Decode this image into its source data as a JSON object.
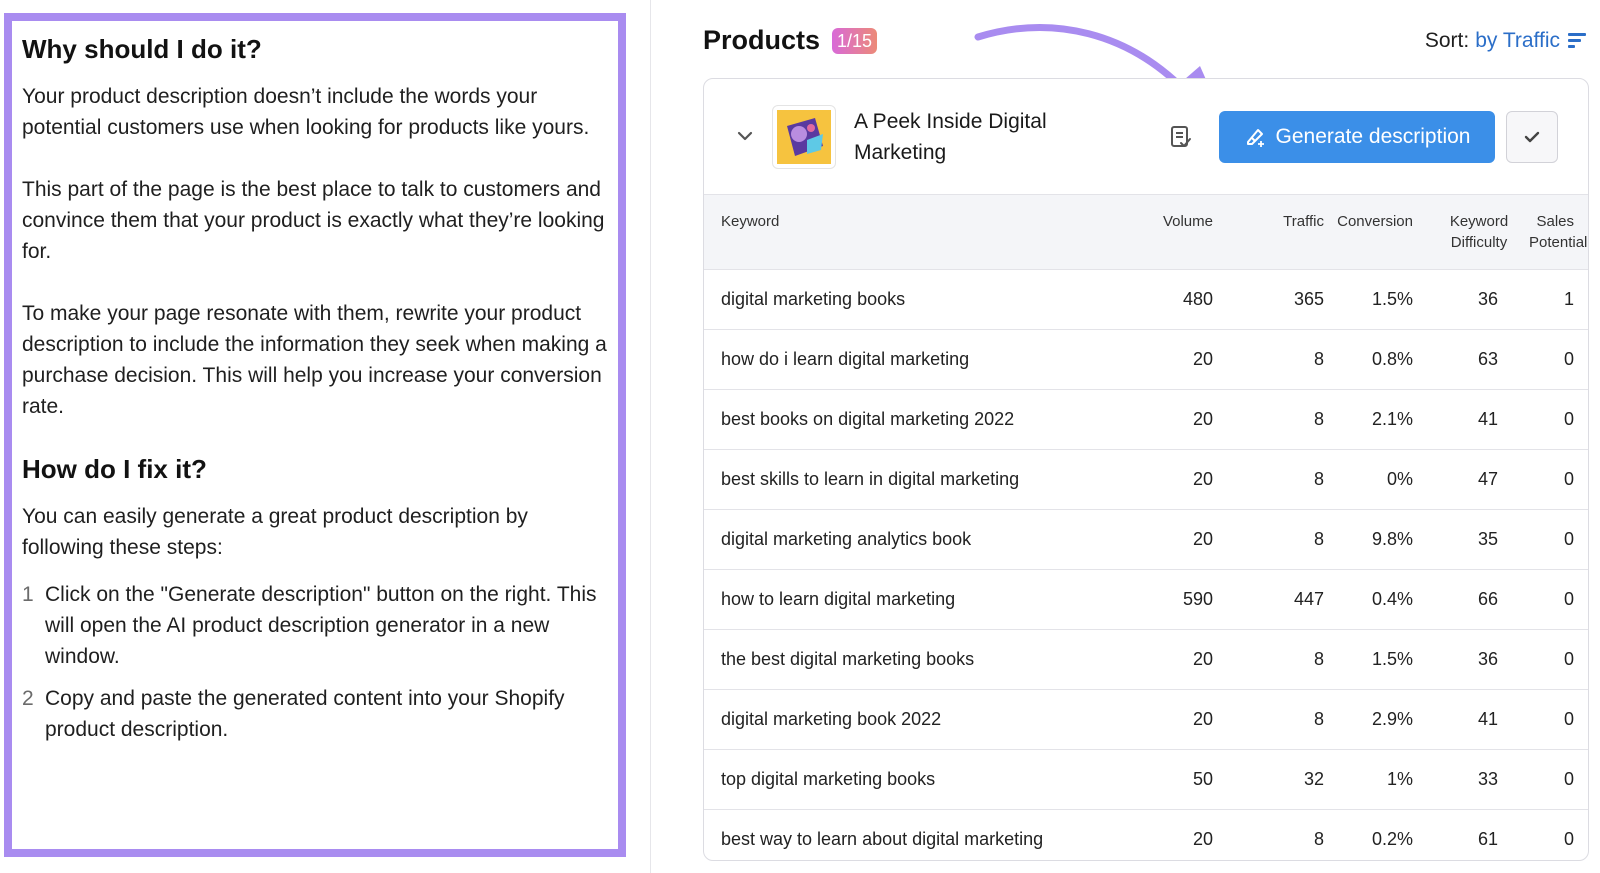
{
  "left": {
    "why_heading": "Why should I do it?",
    "why_p1": "Your product description doesn’t include the words your potential customers use when looking for products like yours.",
    "why_p2": "This part of the page is the best place to talk to customers and convince them that your product is exactly what they’re looking for.",
    "why_p3": "To make your page resonate with them, rewrite your product description to include the information they seek when making a purchase decision. This will help you increase your conversion rate.",
    "fix_heading": "How do I fix it?",
    "fix_intro": "You can easily generate a great product description by following these steps:",
    "steps": [
      {
        "num": "1",
        "text": "Click on the \"Generate description\" button on the right. This will open the AI product description generator in a new window."
      },
      {
        "num": "2",
        "text": "Copy and paste the generated content into your Shopify product description."
      }
    ],
    "highlight_color": "#a98cf0"
  },
  "products": {
    "title": "Products",
    "count_badge": "1/15",
    "sort_label": "Sort:",
    "sort_value": "by Traffic",
    "sort_icon": "sort-lines-icon",
    "product": {
      "name": "A Peek Inside Digital Marketing",
      "thumb_icon": "book-cover-image",
      "expand_icon": "chevron-down-icon",
      "doc_icon": "document-check-icon",
      "generate_label": "Generate description",
      "generate_icon": "magic-pen-icon",
      "check_icon": "check-icon",
      "accent_color": "#3b8fe8"
    },
    "table": {
      "headers": {
        "keyword": "Keyword",
        "volume": "Volume",
        "traffic": "Traffic",
        "conversion": "Conversion",
        "kd_line1": "Keyword",
        "kd_line2": "Difficulty",
        "sp_line1": "Sales",
        "sp_line2": "Potential"
      },
      "rows": [
        {
          "keyword": "digital marketing books",
          "volume": "480",
          "traffic": "365",
          "conversion": "1.5%",
          "kd": "36",
          "sp": "1"
        },
        {
          "keyword": "how do i learn digital marketing",
          "volume": "20",
          "traffic": "8",
          "conversion": "0.8%",
          "kd": "63",
          "sp": "0"
        },
        {
          "keyword": "best books on digital marketing 2022",
          "volume": "20",
          "traffic": "8",
          "conversion": "2.1%",
          "kd": "41",
          "sp": "0"
        },
        {
          "keyword": "best skills to learn in digital marketing",
          "volume": "20",
          "traffic": "8",
          "conversion": "0%",
          "kd": "47",
          "sp": "0"
        },
        {
          "keyword": "digital marketing analytics book",
          "volume": "20",
          "traffic": "8",
          "conversion": "9.8%",
          "kd": "35",
          "sp": "0"
        },
        {
          "keyword": "how to learn digital marketing",
          "volume": "590",
          "traffic": "447",
          "conversion": "0.4%",
          "kd": "66",
          "sp": "0"
        },
        {
          "keyword": "the best digital marketing books",
          "volume": "20",
          "traffic": "8",
          "conversion": "1.5%",
          "kd": "36",
          "sp": "0"
        },
        {
          "keyword": "digital marketing book 2022",
          "volume": "20",
          "traffic": "8",
          "conversion": "2.9%",
          "kd": "41",
          "sp": "0"
        },
        {
          "keyword": "top digital marketing books",
          "volume": "50",
          "traffic": "32",
          "conversion": "1%",
          "kd": "33",
          "sp": "0"
        },
        {
          "keyword": "best way to learn about digital marketing",
          "volume": "20",
          "traffic": "8",
          "conversion": "0.2%",
          "kd": "61",
          "sp": "0"
        }
      ]
    }
  },
  "annotation": {
    "arrow_icon": "curved-arrow-icon",
    "color": "#a98cf0"
  }
}
